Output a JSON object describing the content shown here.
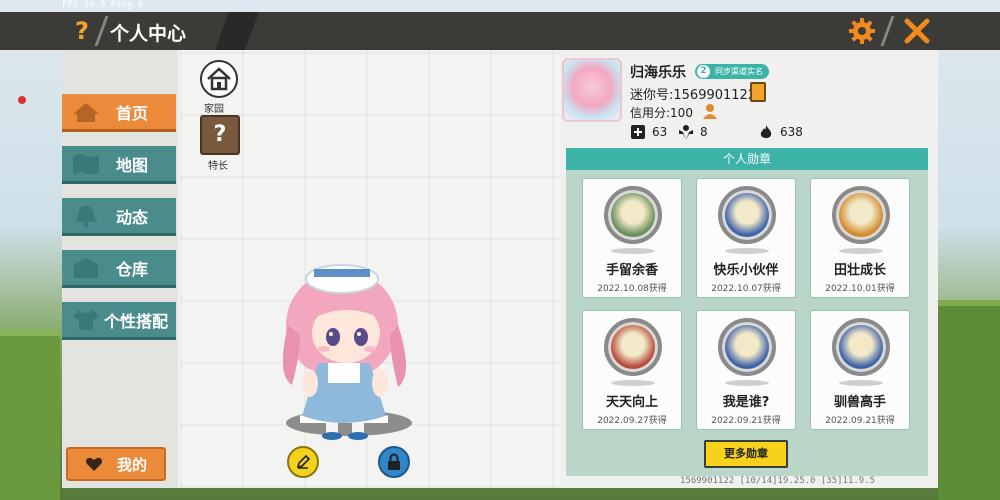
{
  "fps_text": "FPS 29.0  Ping 0",
  "header": {
    "title": "个人中心"
  },
  "nav": [
    {
      "label": "首页",
      "active": true
    },
    {
      "label": "地图"
    },
    {
      "label": "动态"
    },
    {
      "label": "仓库"
    },
    {
      "label": "个性搭配"
    }
  ],
  "mine_label": "我的",
  "left_tools": {
    "home_label": "家园",
    "specialty_label": "特长",
    "specialty_glyph": "?"
  },
  "profile": {
    "nickname": "归海乐乐",
    "sync_badge": "同步渠道实名",
    "mini_id": "迷你号:1569901122",
    "credit": "信用分:100",
    "stats": [
      {
        "icon": "plus-icon",
        "value": "63"
      },
      {
        "icon": "fans-icon",
        "value": "8"
      },
      {
        "icon": "flame-icon",
        "value": "638"
      }
    ]
  },
  "medals": {
    "title": "个人勋章",
    "items": [
      {
        "name": "手留余香",
        "date": "2022.10.08获得",
        "color": "#6a8e5c"
      },
      {
        "name": "快乐小伙伴",
        "date": "2022.10.07获得",
        "color": "#3f62a8"
      },
      {
        "name": "田壮成长",
        "date": "2022.10.01获得",
        "color": "#d28a2e"
      },
      {
        "name": "天天向上",
        "date": "2022.09.27获得",
        "color": "#b84b3c"
      },
      {
        "name": "我是谁?",
        "date": "2022.09.21获得",
        "color": "#3f62a8"
      },
      {
        "name": "驯兽高手",
        "date": "2022.09.21获得",
        "color": "#3f62a8"
      }
    ],
    "more_label": "更多勋章"
  },
  "footer": "1569901122  [10/14]19.25.0  [35]11.9.5",
  "colors": {
    "accent_orange": "#eb8a3b",
    "teal": "#4a8c8c",
    "medal_teal": "#3db3a8",
    "yellow": "#f7d21c"
  }
}
